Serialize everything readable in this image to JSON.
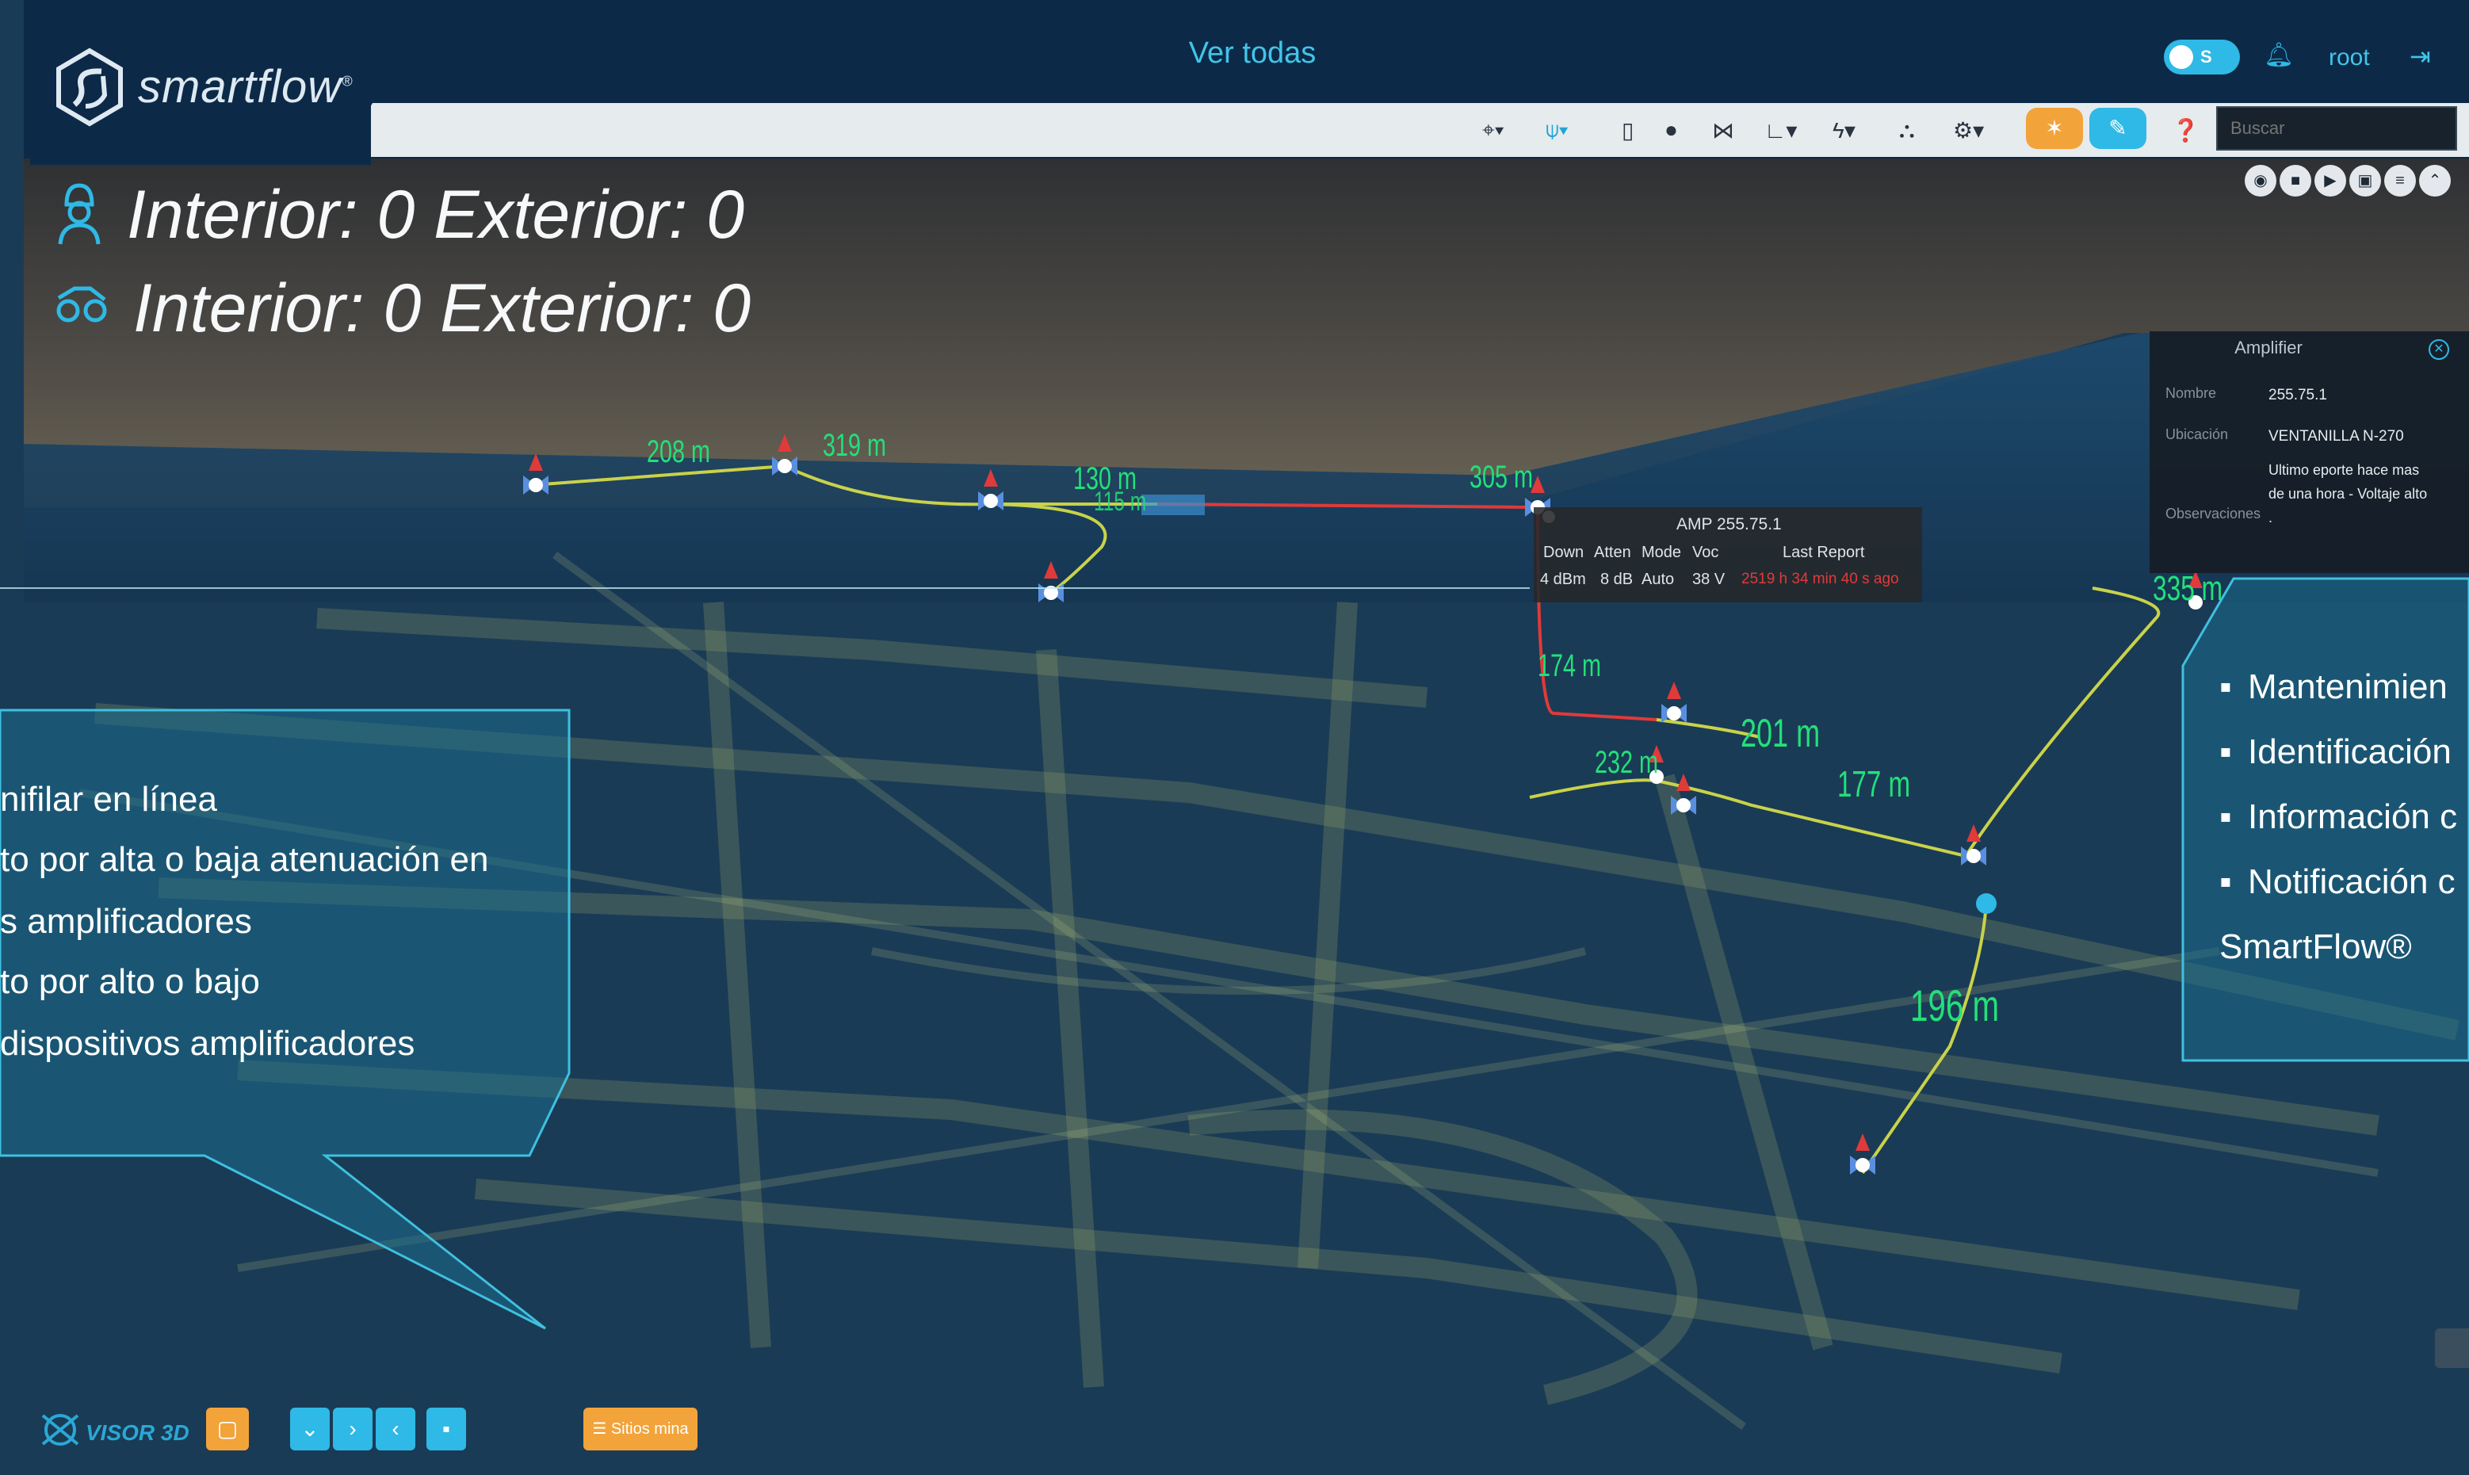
{
  "brand": {
    "name": "smartflow",
    "mark": "®"
  },
  "header": {
    "title": "Ver todas",
    "toggle_label": "S",
    "user": "root"
  },
  "toolbar": {
    "search_placeholder": "Buscar",
    "tools": [
      "location-pin-icon",
      "antenna-icon",
      "device-icon",
      "marker-icon",
      "topology-icon",
      "route-icon",
      "power-icon",
      "hierarchy-icon",
      "settings-icon"
    ],
    "action_buttons": [
      {
        "icon": "person-icon",
        "color": "#f2a33a"
      },
      {
        "icon": "edit-icon",
        "color": "#2fb9e6"
      }
    ]
  },
  "counters": [
    {
      "icon": "worker-icon",
      "text": "Interior: 0 Exterior: 0"
    },
    {
      "icon": "vehicle-icon",
      "text": "Interior: 0 Exterior: 0"
    }
  ],
  "amplifier_panel": {
    "title": "Amplifier",
    "fields": [
      {
        "label": "Nombre",
        "value": "255.75.1"
      },
      {
        "label": "Ubicación",
        "value": "VENTANILLA N-270"
      }
    ],
    "observaciones_label": "Observaciones",
    "observaciones": [
      "Ultimo eporte hace mas",
      "de una hora - Voltaje alto",
      "."
    ]
  },
  "popup": {
    "title": "AMP 255.75.1",
    "headers": [
      "Down",
      "Atten",
      "Mode",
      "Voc",
      "Last Report"
    ],
    "values": [
      "4 dBm",
      "8 dB",
      "Auto",
      "38 V",
      "2519 h 34 min 40 s ago"
    ],
    "alert_color": "#e03a3a"
  },
  "distances": [
    "208 m",
    "319 m",
    "130 m",
    "115 m",
    "305 m",
    "174 m",
    "201 m",
    "232 m",
    "177 m",
    "196 m",
    "335 m"
  ],
  "left_callout": {
    "lines": [
      "nifilar en línea",
      "to por alta o baja atenuación en",
      "s amplificadores",
      "to por alto o bajo",
      "dispositivos amplificadores"
    ]
  },
  "right_callout": {
    "bullets": [
      "Mantenimien",
      "Identificación",
      "Información c",
      "Notificación c"
    ],
    "footer": "SmartFlow®"
  },
  "bottom": {
    "visor_label": "VISOR 3D",
    "sites_button": "Sitios mina",
    "nav_buttons": [
      "download-icon",
      "next-icon",
      "prev-icon",
      "save-icon"
    ]
  },
  "colors": {
    "accent": "#2fb9e6",
    "header_bg": "#0c2a48",
    "distance_text": "#23e07a",
    "cable": "#c9d24a",
    "alert": "#e03a3a"
  }
}
